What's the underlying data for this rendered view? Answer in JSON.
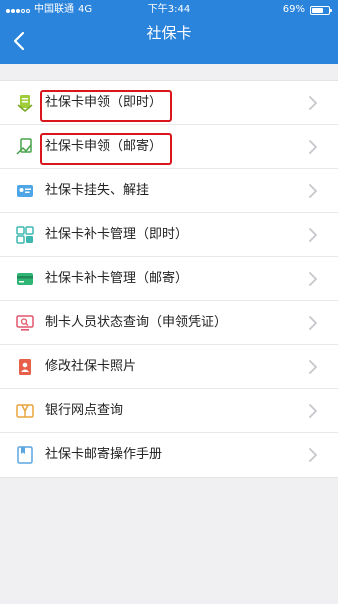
{
  "status_bar": {
    "carrier": "中国联通",
    "network": "4G",
    "time": "下午3:44",
    "battery_text": "69%",
    "battery_level": 0.69
  },
  "nav": {
    "title": "社保卡"
  },
  "menu": {
    "items": [
      {
        "label": "社保卡申领（即时）",
        "icon": "card-apply-instant-icon",
        "highlighted": true
      },
      {
        "label": "社保卡申领（邮寄）",
        "icon": "card-apply-mail-icon",
        "highlighted": true
      },
      {
        "label": "社保卡挂失、解挂",
        "icon": "card-loss-report-icon",
        "highlighted": false
      },
      {
        "label": "社保卡补卡管理（即时）",
        "icon": "card-reissue-instant-icon",
        "highlighted": false
      },
      {
        "label": "社保卡补卡管理（邮寄）",
        "icon": "card-reissue-mail-icon",
        "highlighted": false
      },
      {
        "label": "制卡人员状态查询（申领凭证）",
        "icon": "status-query-icon",
        "highlighted": false
      },
      {
        "label": "修改社保卡照片",
        "icon": "photo-edit-icon",
        "highlighted": false
      },
      {
        "label": "银行网点查询",
        "icon": "bank-branch-icon",
        "highlighted": false
      },
      {
        "label": "社保卡邮寄操作手册",
        "icon": "manual-icon",
        "highlighted": false
      }
    ]
  },
  "colors": {
    "header": "#2a84dc",
    "highlight": "#d8161c",
    "background": "#f0f0f2"
  }
}
